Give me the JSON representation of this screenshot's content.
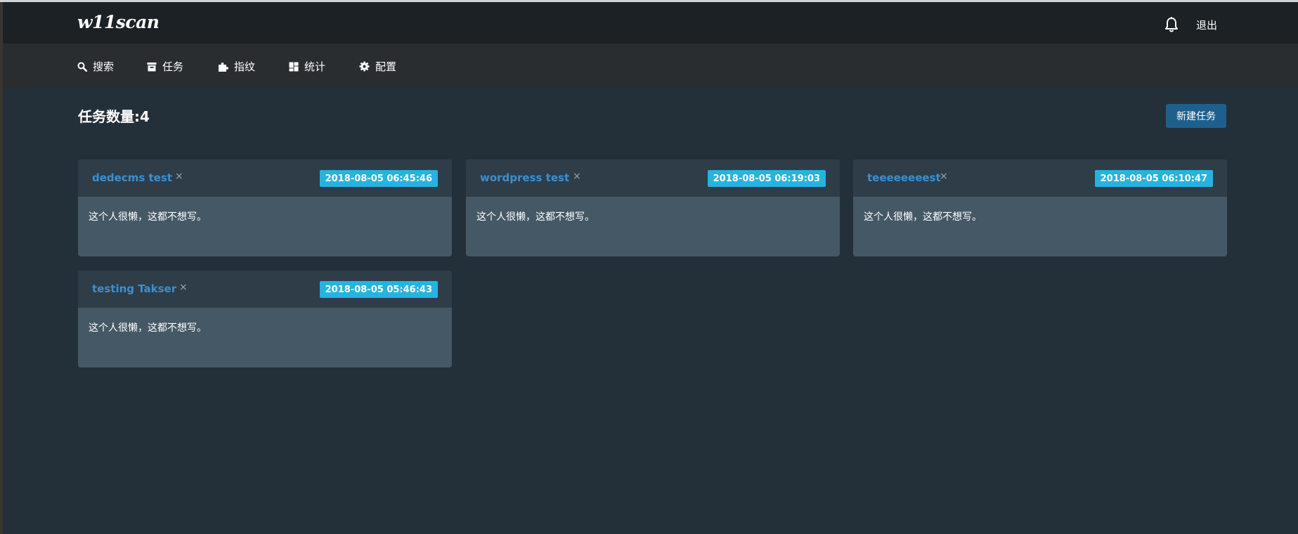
{
  "header": {
    "brand": "w11scan",
    "logout_label": "退出"
  },
  "nav": {
    "items": [
      {
        "label": "搜索",
        "icon": "search-icon"
      },
      {
        "label": "任务",
        "icon": "archive-icon"
      },
      {
        "label": "指纹",
        "icon": "puzzle-icon"
      },
      {
        "label": "统计",
        "icon": "dashboard-icon"
      },
      {
        "label": "配置",
        "icon": "gear-icon"
      }
    ]
  },
  "main": {
    "title": "任务数量:4",
    "new_task_label": "新建任务",
    "tasks": [
      {
        "name": "dedecms test",
        "date": "2018-08-05 06:45:46",
        "description": "这个人很懒，这都不想写。",
        "close": "×"
      },
      {
        "name": "wordpress test",
        "date": "2018-08-05 06:19:03",
        "description": "这个人很懒，这都不想写。",
        "close": "×"
      },
      {
        "name": "teeeeeeeest",
        "date": "2018-08-05 06:10:47",
        "description": "这个人很懒，这都不想写。",
        "close": "×"
      },
      {
        "name": "testing Takser",
        "date": "2018-08-05 05:46:43",
        "description": "这个人很懒，这都不想写。",
        "close": "×"
      }
    ]
  },
  "colors": {
    "page_bg": "#243039",
    "topbar_bg": "#1c2125",
    "navbar_bg": "#2a2d30",
    "card_header_bg": "#2e3d48",
    "card_body_bg": "#455866",
    "title_link": "#3d8fcf",
    "date_badge": "#26b3df",
    "button_bg": "#1f5f8e"
  }
}
